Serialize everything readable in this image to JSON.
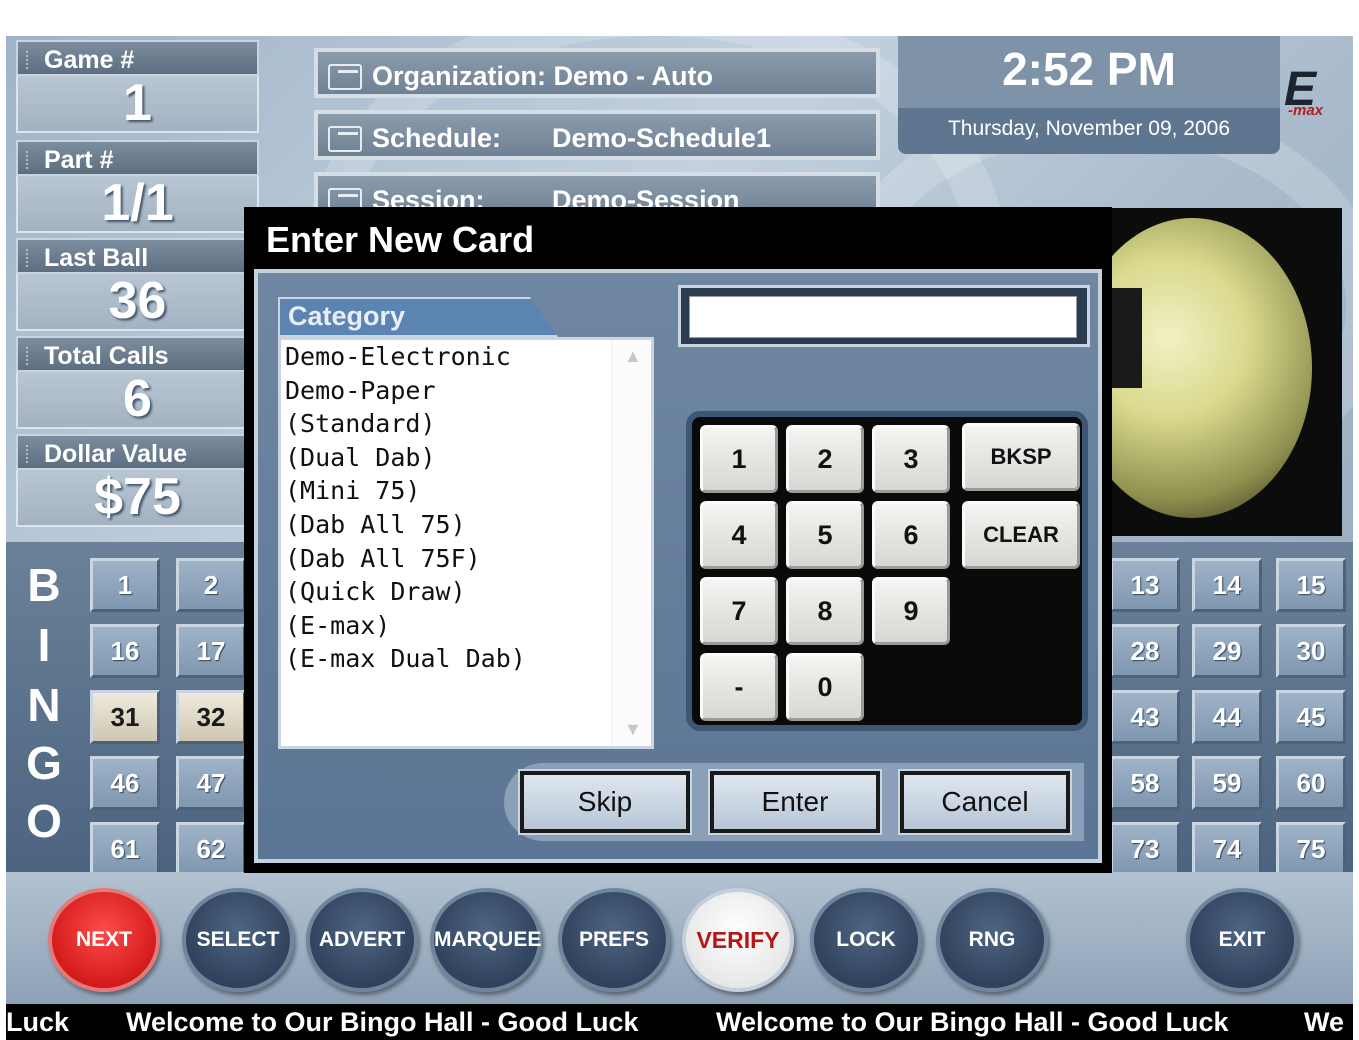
{
  "stats": [
    {
      "label": "Game #",
      "value": "1"
    },
    {
      "label": "Part #",
      "value": "1/1"
    },
    {
      "label": "Last Ball",
      "value": "36"
    },
    {
      "label": "Total Calls",
      "value": "6"
    },
    {
      "label": "Dollar Value",
      "value": "$75"
    }
  ],
  "info": {
    "organization_key": "Organization:",
    "organization_val": "Demo - Auto",
    "schedule_key": "Schedule:",
    "schedule_val": "Demo-Schedule1",
    "session_key": "Session:",
    "session_val": "Demo-Session"
  },
  "clock": {
    "time": "2:52 PM",
    "date": "Thursday, November 09, 2006"
  },
  "logo": {
    "main": "E",
    "sub": "-max"
  },
  "board": {
    "letters": [
      "B",
      "I",
      "N",
      "G",
      "O"
    ],
    "rows": [
      {
        "left": [
          "1",
          "2"
        ],
        "right": [
          "13",
          "14",
          "15"
        ]
      },
      {
        "left": [
          "16",
          "17"
        ],
        "right": [
          "28",
          "29",
          "30"
        ]
      },
      {
        "left": [
          "31",
          "32"
        ],
        "right": [
          "43",
          "44",
          "45"
        ]
      },
      {
        "left": [
          "46",
          "47"
        ],
        "right": [
          "58",
          "59",
          "60"
        ]
      },
      {
        "left": [
          "61",
          "62"
        ],
        "right": [
          "73",
          "74",
          "75"
        ]
      }
    ],
    "called": [
      "31",
      "32"
    ]
  },
  "nav": [
    {
      "label": "NEXT",
      "style": "red"
    },
    {
      "label": "SELECT",
      "style": "dark"
    },
    {
      "label": "ADVERT",
      "style": "dark"
    },
    {
      "label": "MARQUEE",
      "style": "dark"
    },
    {
      "label": "PREFS",
      "style": "dark"
    },
    {
      "label": "VERIFY",
      "style": "white"
    },
    {
      "label": "LOCK",
      "style": "dark"
    },
    {
      "label": "RNG",
      "style": "dark"
    },
    {
      "label": "EXIT",
      "style": "dark"
    }
  ],
  "marquee": [
    "Luck",
    "Welcome to Our Bingo Hall - Good Luck",
    "Welcome to Our Bingo Hall - Good Luck",
    "We"
  ],
  "dialog": {
    "title": "Enter New Card",
    "category_label": "Category",
    "categories": [
      "Demo-Electronic",
      "Demo-Paper",
      " (Standard)",
      " (Dual Dab)",
      " (Mini 75)",
      " (Dab All 75)",
      " (Dab All 75F)",
      " (Quick Draw)",
      " (E-max)",
      " (E-max Dual Dab)"
    ],
    "entry_value": "",
    "keys": [
      "1",
      "2",
      "3",
      "4",
      "5",
      "6",
      "7",
      "8",
      "9",
      "-",
      "0"
    ],
    "bksp": "BKSP",
    "clear": "CLEAR",
    "skip": "Skip",
    "enter": "Enter",
    "cancel": "Cancel"
  },
  "colors": {
    "accent_red": "#d11818",
    "board_blue": "#5a7190",
    "dialog_bg": "#000000"
  }
}
